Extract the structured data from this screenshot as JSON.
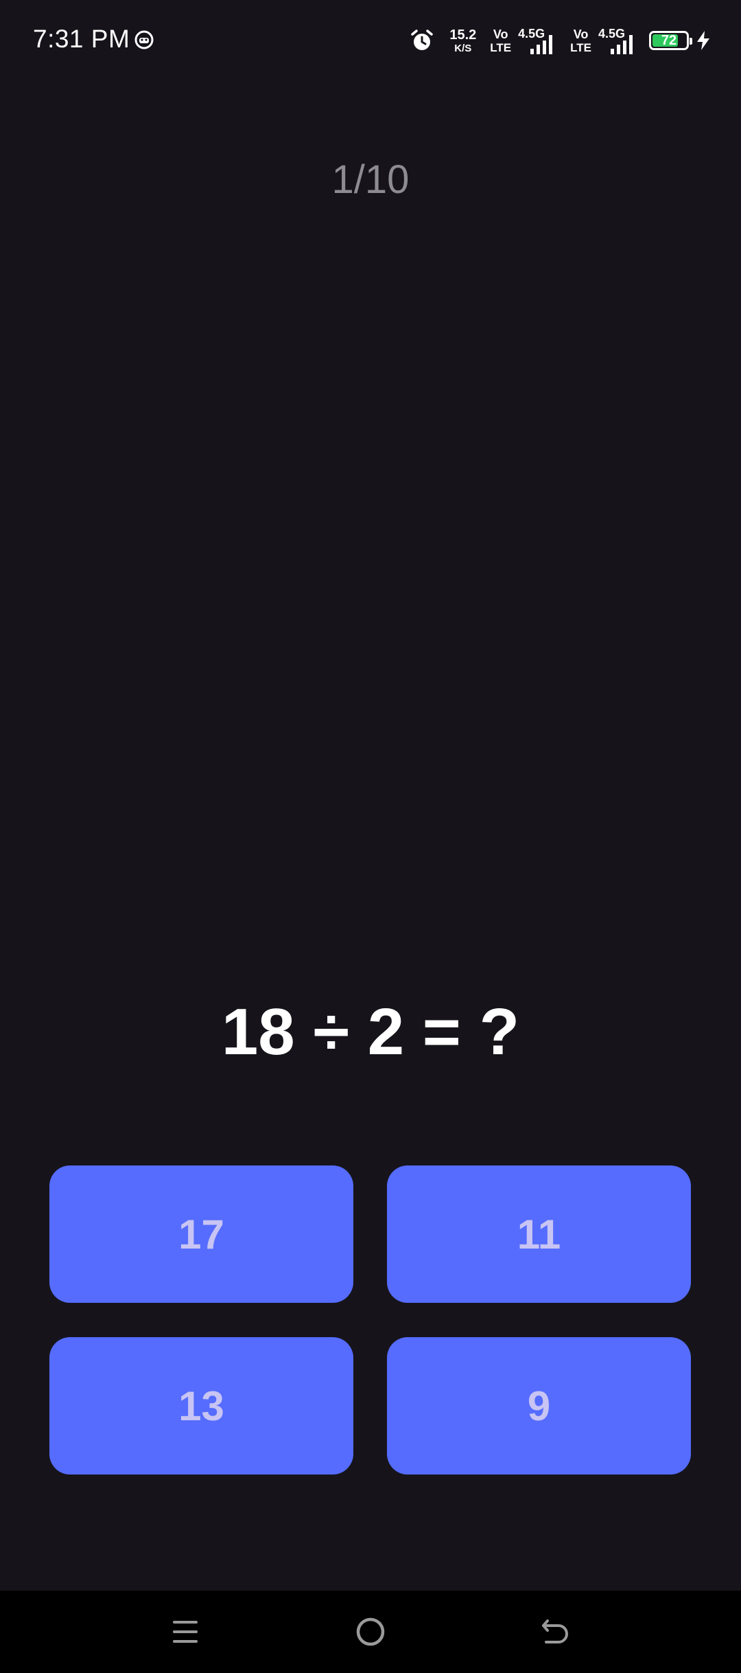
{
  "status_bar": {
    "time": "7:31 PM",
    "net_speed_value": "15.2",
    "net_speed_unit": "K/S",
    "sim1_volte_top": "Vo",
    "sim1_volte_bottom": "LTE",
    "sim1_network": "4.5G",
    "sim2_volte_top": "Vo",
    "sim2_volte_bottom": "LTE",
    "sim2_network": "4.5G",
    "battery_level": "72"
  },
  "quiz": {
    "progress": "1/10",
    "question": "18 ÷ 2 = ?",
    "answers": [
      "17",
      "11",
      "13",
      "9"
    ]
  },
  "colors": {
    "background": "#16141a",
    "answer_button": "#556cfe",
    "answer_text": "#c8c4f3",
    "progress_text": "#8e8c93",
    "battery_fill": "#2ec95c"
  },
  "icons": {
    "status_app": "app-notification-icon",
    "alarm": "alarm-icon",
    "charging": "charging-bolt-icon",
    "nav_menu": "menu-icon",
    "nav_home": "home-icon",
    "nav_back": "back-icon"
  }
}
